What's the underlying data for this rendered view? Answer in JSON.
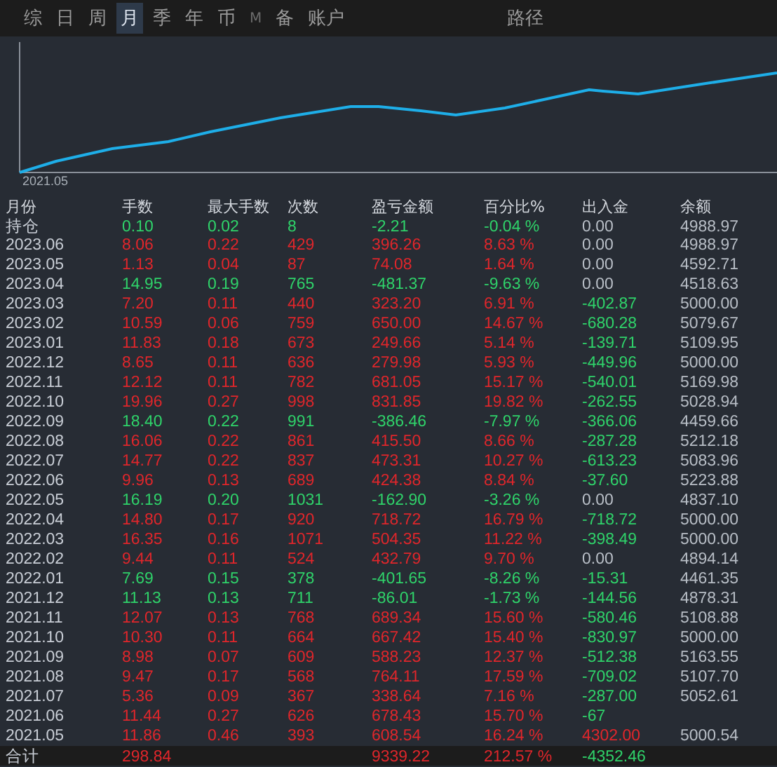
{
  "tabs": [
    {
      "label": "综",
      "selected": false,
      "disabled": false
    },
    {
      "label": "日",
      "selected": false,
      "disabled": false
    },
    {
      "label": "周",
      "selected": false,
      "disabled": false
    },
    {
      "label": "月",
      "selected": true,
      "disabled": false
    },
    {
      "label": "季",
      "selected": false,
      "disabled": false
    },
    {
      "label": "年",
      "selected": false,
      "disabled": false
    },
    {
      "label": "币",
      "selected": false,
      "disabled": false
    },
    {
      "label": "M",
      "selected": false,
      "disabled": true
    },
    {
      "label": "备",
      "selected": false,
      "disabled": false
    },
    {
      "label": "账户",
      "selected": false,
      "disabled": false
    },
    {
      "label": "路径",
      "selected": false,
      "disabled": false
    }
  ],
  "chart": {
    "start_label": "2021.05"
  },
  "table": {
    "columns": [
      "月份",
      "手数",
      "最大手数",
      "次数",
      "盈亏金额",
      "百分比%",
      "出入金",
      "余额"
    ],
    "rows": [
      {
        "month": "持仓",
        "kind": "loss",
        "lots": "0.10",
        "max_lots": "0.02",
        "trades": "8",
        "pnl": "-2.21",
        "pct": "-0.04 %",
        "flow": {
          "text": "0.00",
          "kind": "none"
        },
        "balance": "4988.97"
      },
      {
        "month": "2023.06",
        "kind": "gain",
        "lots": "8.06",
        "max_lots": "0.22",
        "trades": "429",
        "pnl": "396.26",
        "pct": "8.63 %",
        "flow": {
          "text": "0.00",
          "kind": "none"
        },
        "balance": "4988.97"
      },
      {
        "month": "2023.05",
        "kind": "gain",
        "lots": "1.13",
        "max_lots": "0.04",
        "trades": "87",
        "pnl": "74.08",
        "pct": "1.64 %",
        "flow": {
          "text": "0.00",
          "kind": "none"
        },
        "balance": "4592.71"
      },
      {
        "month": "2023.04",
        "kind": "loss",
        "lots": "14.95",
        "max_lots": "0.19",
        "trades": "765",
        "pnl": "-481.37",
        "pct": "-9.63 %",
        "flow": {
          "text": "0.00",
          "kind": "none"
        },
        "balance": "4518.63"
      },
      {
        "month": "2023.03",
        "kind": "gain",
        "lots": "7.20",
        "max_lots": "0.11",
        "trades": "440",
        "pnl": "323.20",
        "pct": "6.91 %",
        "flow": {
          "text": "-402.87",
          "kind": "out"
        },
        "balance": "5000.00"
      },
      {
        "month": "2023.02",
        "kind": "gain",
        "lots": "10.59",
        "max_lots": "0.06",
        "trades": "759",
        "pnl": "650.00",
        "pct": "14.67 %",
        "flow": {
          "text": "-680.28",
          "kind": "out"
        },
        "balance": "5079.67"
      },
      {
        "month": "2023.01",
        "kind": "gain",
        "lots": "11.83",
        "max_lots": "0.18",
        "trades": "673",
        "pnl": "249.66",
        "pct": "5.14 %",
        "flow": {
          "text": "-139.71",
          "kind": "out"
        },
        "balance": "5109.95"
      },
      {
        "month": "2022.12",
        "kind": "gain",
        "lots": "8.65",
        "max_lots": "0.11",
        "trades": "636",
        "pnl": "279.98",
        "pct": "5.93 %",
        "flow": {
          "text": "-449.96",
          "kind": "out"
        },
        "balance": "5000.00"
      },
      {
        "month": "2022.11",
        "kind": "gain",
        "lots": "12.12",
        "max_lots": "0.11",
        "trades": "782",
        "pnl": "681.05",
        "pct": "15.17 %",
        "flow": {
          "text": "-540.01",
          "kind": "out"
        },
        "balance": "5169.98"
      },
      {
        "month": "2022.10",
        "kind": "gain",
        "lots": "19.96",
        "max_lots": "0.27",
        "trades": "998",
        "pnl": "831.85",
        "pct": "19.82 %",
        "flow": {
          "text": "-262.55",
          "kind": "out"
        },
        "balance": "5028.94"
      },
      {
        "month": "2022.09",
        "kind": "loss",
        "lots": "18.40",
        "max_lots": "0.22",
        "trades": "991",
        "pnl": "-386.46",
        "pct": "-7.97 %",
        "flow": {
          "text": "-366.06",
          "kind": "out"
        },
        "balance": "4459.66"
      },
      {
        "month": "2022.08",
        "kind": "gain",
        "lots": "16.06",
        "max_lots": "0.22",
        "trades": "861",
        "pnl": "415.50",
        "pct": "8.66 %",
        "flow": {
          "text": "-287.28",
          "kind": "out"
        },
        "balance": "5212.18"
      },
      {
        "month": "2022.07",
        "kind": "gain",
        "lots": "14.77",
        "max_lots": "0.22",
        "trades": "837",
        "pnl": "473.31",
        "pct": "10.27 %",
        "flow": {
          "text": "-613.23",
          "kind": "out"
        },
        "balance": "5083.96"
      },
      {
        "month": "2022.06",
        "kind": "gain",
        "lots": "9.96",
        "max_lots": "0.13",
        "trades": "689",
        "pnl": "424.38",
        "pct": "8.84 %",
        "flow": {
          "text": "-37.60",
          "kind": "out"
        },
        "balance": "5223.88"
      },
      {
        "month": "2022.05",
        "kind": "loss",
        "lots": "16.19",
        "max_lots": "0.20",
        "trades": "1031",
        "pnl": "-162.90",
        "pct": "-3.26 %",
        "flow": {
          "text": "0.00",
          "kind": "none"
        },
        "balance": "4837.10"
      },
      {
        "month": "2022.04",
        "kind": "gain",
        "lots": "14.80",
        "max_lots": "0.17",
        "trades": "920",
        "pnl": "718.72",
        "pct": "16.79 %",
        "flow": {
          "text": "-718.72",
          "kind": "out"
        },
        "balance": "5000.00"
      },
      {
        "month": "2022.03",
        "kind": "gain",
        "lots": "16.35",
        "max_lots": "0.16",
        "trades": "1071",
        "pnl": "504.35",
        "pct": "11.22 %",
        "flow": {
          "text": "-398.49",
          "kind": "out"
        },
        "balance": "5000.00"
      },
      {
        "month": "2022.02",
        "kind": "gain",
        "lots": "9.44",
        "max_lots": "0.11",
        "trades": "524",
        "pnl": "432.79",
        "pct": "9.70 %",
        "flow": {
          "text": "0.00",
          "kind": "none"
        },
        "balance": "4894.14"
      },
      {
        "month": "2022.01",
        "kind": "loss",
        "lots": "7.69",
        "max_lots": "0.15",
        "trades": "378",
        "pnl": "-401.65",
        "pct": "-8.26 %",
        "flow": {
          "text": "-15.31",
          "kind": "out"
        },
        "balance": "4461.35"
      },
      {
        "month": "2021.12",
        "kind": "loss",
        "lots": "11.13",
        "max_lots": "0.13",
        "trades": "711",
        "pnl": "-86.01",
        "pct": "-1.73 %",
        "flow": {
          "text": "-144.56",
          "kind": "out"
        },
        "balance": "4878.31"
      },
      {
        "month": "2021.11",
        "kind": "gain",
        "lots": "12.07",
        "max_lots": "0.13",
        "trades": "768",
        "pnl": "689.34",
        "pct": "15.60 %",
        "flow": {
          "text": "-580.46",
          "kind": "out"
        },
        "balance": "5108.88"
      },
      {
        "month": "2021.10",
        "kind": "gain",
        "lots": "10.30",
        "max_lots": "0.11",
        "trades": "664",
        "pnl": "667.42",
        "pct": "15.40 %",
        "flow": {
          "text": "-830.97",
          "kind": "out"
        },
        "balance": "5000.00"
      },
      {
        "month": "2021.09",
        "kind": "gain",
        "lots": "8.98",
        "max_lots": "0.07",
        "trades": "609",
        "pnl": "588.23",
        "pct": "12.37 %",
        "flow": {
          "text": "-512.38",
          "kind": "out"
        },
        "balance": "5163.55"
      },
      {
        "month": "2021.08",
        "kind": "gain",
        "lots": "9.47",
        "max_lots": "0.17",
        "trades": "568",
        "pnl": "764.11",
        "pct": "17.59 %",
        "flow": {
          "text": "-709.02",
          "kind": "out"
        },
        "balance": "5107.70"
      },
      {
        "month": "2021.07",
        "kind": "gain",
        "lots": "5.36",
        "max_lots": "0.09",
        "trades": "367",
        "pnl": "338.64",
        "pct": "7.16 %",
        "flow": {
          "text": "-287.00",
          "kind": "out"
        },
        "balance": "5052.61"
      },
      {
        "month": "2021.06",
        "kind": "gain",
        "lots": "11.44",
        "max_lots": "0.27",
        "trades": "626",
        "pnl": "678.43",
        "pct": "15.70 %",
        "flow": {
          "text": "-67",
          "kind": "out"
        }
      },
      {
        "month": "2021.05",
        "kind": "gain",
        "lots": "11.86",
        "max_lots": "0.46",
        "trades": "393",
        "pnl": "608.54",
        "pct": "16.24 %",
        "flow": {
          "text": "4302.00",
          "kind": "in"
        },
        "balance": "5000.54"
      }
    ],
    "total": {
      "label": "合计",
      "lots": "298.84",
      "pnl": "9339.22",
      "pct": "212.57 %",
      "flow": "-4352.46"
    }
  }
}
